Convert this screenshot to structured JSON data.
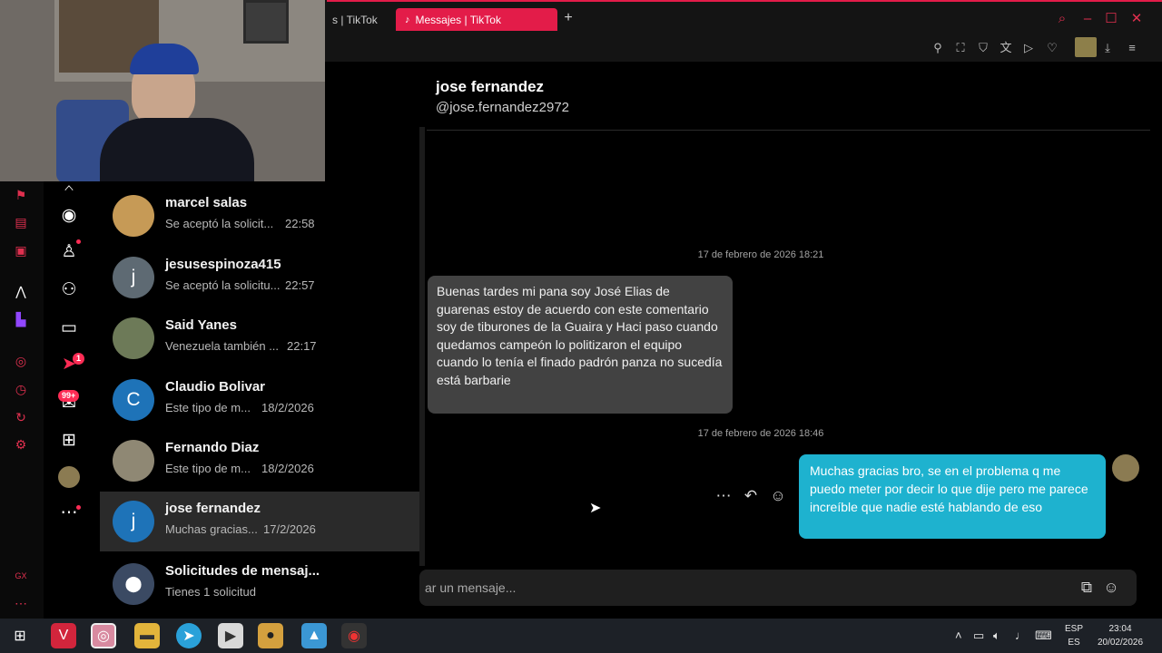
{
  "browser": {
    "tabs": [
      {
        "label": "s | TikTok"
      },
      {
        "label": "Messajes | TikTok"
      }
    ],
    "new_tab_label": "+"
  },
  "conversations": [
    {
      "name": "marcel salas",
      "preview": "Se aceptó la solicit...",
      "time": "22:58",
      "initial": ""
    },
    {
      "name": "jesusespinoza415",
      "preview": "Se aceptó la solicitu...",
      "time": "22:57",
      "initial": "j"
    },
    {
      "name": "Said Yanes",
      "preview": "Venezuela también ...",
      "time": "22:17",
      "initial": ""
    },
    {
      "name": "Claudio Bolivar",
      "preview": "Este tipo de m...",
      "time": "18/2/2026",
      "initial": "C"
    },
    {
      "name": "Fernando Diaz",
      "preview": "Este tipo de m...",
      "time": "18/2/2026",
      "initial": ""
    },
    {
      "name": "jose fernandez",
      "preview": "Muchas gracias...",
      "time": "17/2/2026",
      "initial": "j"
    },
    {
      "name": "Solicitudes de mensaj...",
      "preview": "Tienes 1 solicitud",
      "time": "",
      "initial": ""
    }
  ],
  "rail_badges": {
    "notifications": "1",
    "inbox": "99+"
  },
  "chat": {
    "peer_name": "jose fernandez",
    "peer_handle": "@jose.fernandez2972",
    "timestamps": [
      "17 de febrero de 2026 18:21",
      "17 de febrero de 2026 18:46"
    ],
    "incoming": "Buenas tardes mi pana soy José Elias de guarenas estoy de acuerdo con este comentario soy de tiburones de la Guaira y Haci paso cuando quedamos campeón lo politizaron el equipo cuando lo tenía el finado padrón panza no sucedía está barbarie",
    "outgoing": "Muchas gracias bro, se en el problema q me puedo meter por decir lo que dije pero me parece increíble que nadie esté hablando de eso",
    "composer_placeholder": "ar un mensaje..."
  },
  "taskbar": {
    "lang": [
      "ESP",
      "ES"
    ],
    "clock_time": "23:04",
    "clock_date": "20/02/2026"
  },
  "colors": {
    "accent": "#e31c49",
    "outgoing_bubble": "#1eb2cf",
    "incoming_bubble": "#424242"
  }
}
